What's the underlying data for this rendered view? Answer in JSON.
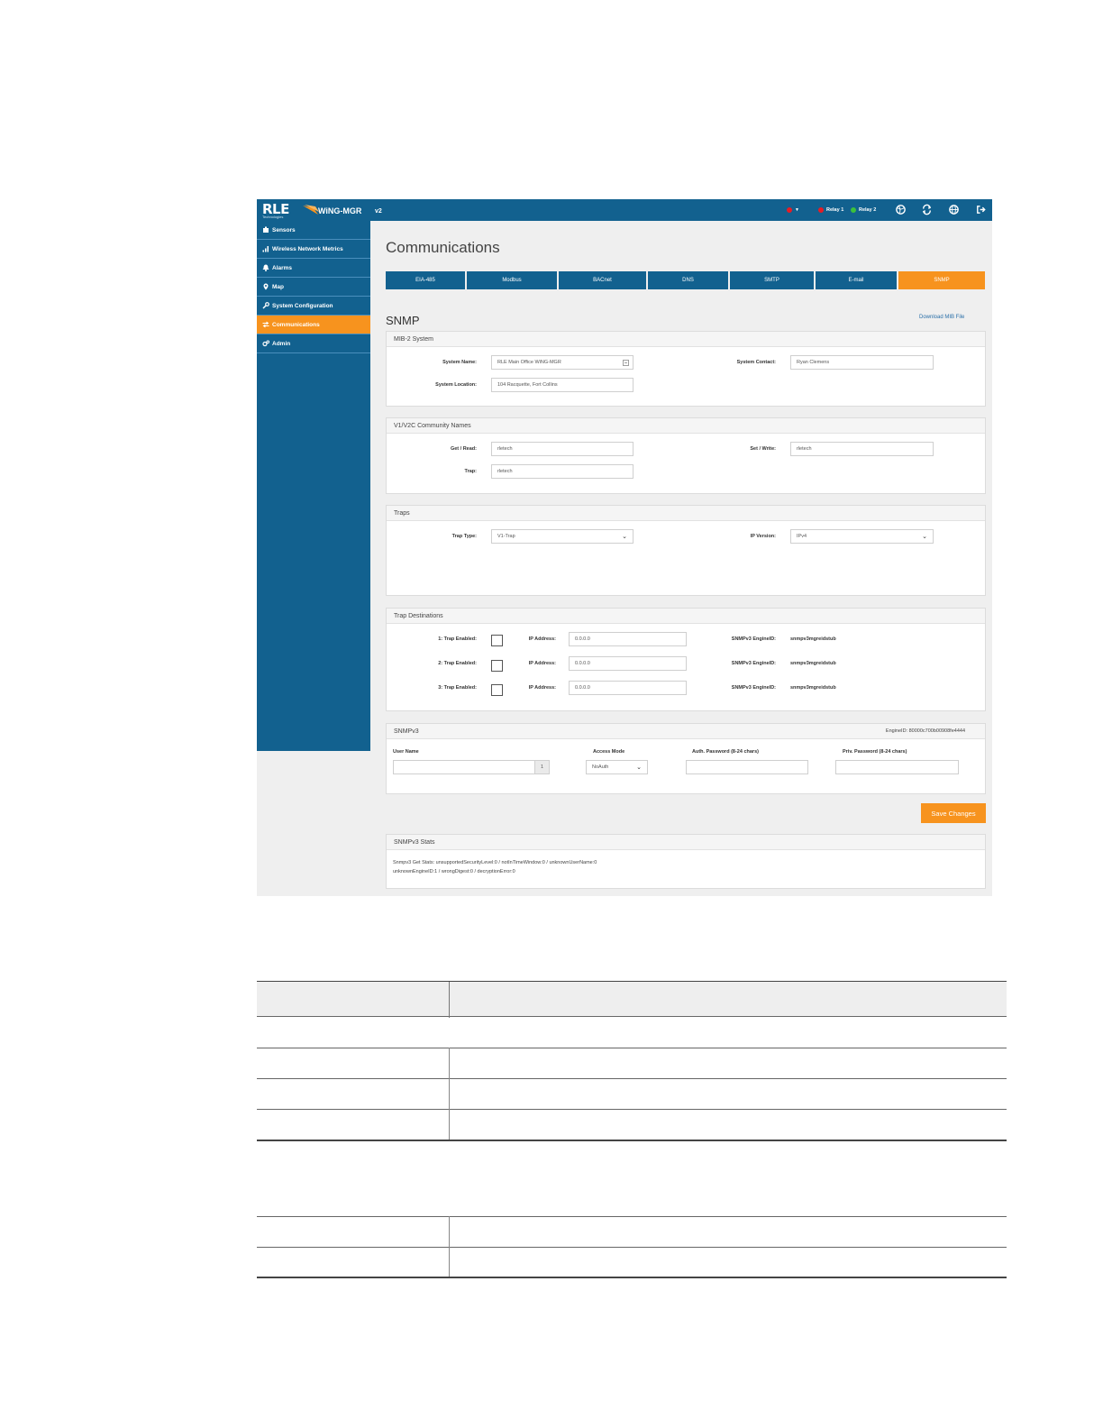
{
  "app": {
    "logo_text": "RLE",
    "logo_subtext": "Technologies",
    "product_name": "WiNG-MGR",
    "version": "v2"
  },
  "topbar": {
    "relay1": "Relay 1",
    "relay2": "Relay 2",
    "status_red": "#e81c24",
    "status_green": "#3cc13b",
    "icons": [
      "language-icon",
      "refresh-icon",
      "globe-icon",
      "logout-icon"
    ]
  },
  "sidebar": {
    "items": [
      {
        "label": "Sensors",
        "icon": "sensor-icon"
      },
      {
        "label": "Wireless Network Metrics",
        "icon": "signal-bars-icon"
      },
      {
        "label": "Alarms",
        "icon": "bell-icon"
      },
      {
        "label": "Map",
        "icon": "map-pin-icon"
      },
      {
        "label": "System Configuration",
        "icon": "wrench-icon"
      },
      {
        "label": "Communications",
        "icon": "communications-icon",
        "active": true
      },
      {
        "label": "Admin",
        "icon": "gears-icon"
      }
    ]
  },
  "page": {
    "title": "Communications",
    "section": "SNMP",
    "mib_link": "Download MIB File"
  },
  "tabs": [
    "EIA-485",
    "Modbus",
    "BACnet",
    "DNS",
    "SMTP",
    "E-mail",
    "SNMP"
  ],
  "mib2": {
    "heading": "MIB-2 System",
    "system_name_label": "System Name:",
    "system_name_value": "RLE Main Office WiNG-MGR",
    "system_contact_label": "System Contact:",
    "system_contact_value": "Ryan Clemens",
    "system_location_label": "System Location:",
    "system_location_value": "104 Racquette, Fort Collins"
  },
  "community": {
    "heading": "V1/V2C Community Names",
    "get_read_label": "Get / Read:",
    "get_read_value": "rletech",
    "set_write_label": "Set / Write:",
    "set_write_value": "rletech",
    "trap_label": "Trap:",
    "trap_value": "rletech"
  },
  "traps": {
    "heading": "Traps",
    "trap_type_label": "Trap Type:",
    "trap_type_value": "V1-Trap",
    "ip_version_label": "IP Version:",
    "ip_version_value": "IPv4"
  },
  "trap_destinations": {
    "heading": "Trap Destinations",
    "ip_label": "IP Address:",
    "engine_label": "SNMPv3 EngineID:",
    "rows": [
      {
        "enabled_label": "1: Trap Enabled:",
        "ip": "0.0.0.0",
        "engine_id": "snmpv3mgreidstub"
      },
      {
        "enabled_label": "2: Trap Enabled:",
        "ip": "0.0.0.0",
        "engine_id": "snmpv3mgreidstub"
      },
      {
        "enabled_label": "3: Trap Enabled:",
        "ip": "0.0.0.0",
        "engine_id": "snmpv3mgreidstub"
      }
    ]
  },
  "snmpv3": {
    "heading": "SNMPv3",
    "engine_id": "EngineID: 80000c700b00908fe4444",
    "user_name_label": "User Name",
    "user_index": "1",
    "access_mode_label": "Access Mode",
    "access_mode_value": "NoAuth",
    "auth_password_label": "Auth. Password (8-24 chars)",
    "priv_password_label": "Priv. Password (8-24 chars)"
  },
  "save_button": "Save Changes",
  "stats": {
    "heading": "SNMPv3 Stats",
    "line1": "Snmpv3 Get Stats: unsupportedSecurityLevel:0 / notInTimeWindow:0 / unknownUserName:0",
    "line2": "unknownEngineID:1 / wrongDigest:0 / decryptionError:0"
  }
}
